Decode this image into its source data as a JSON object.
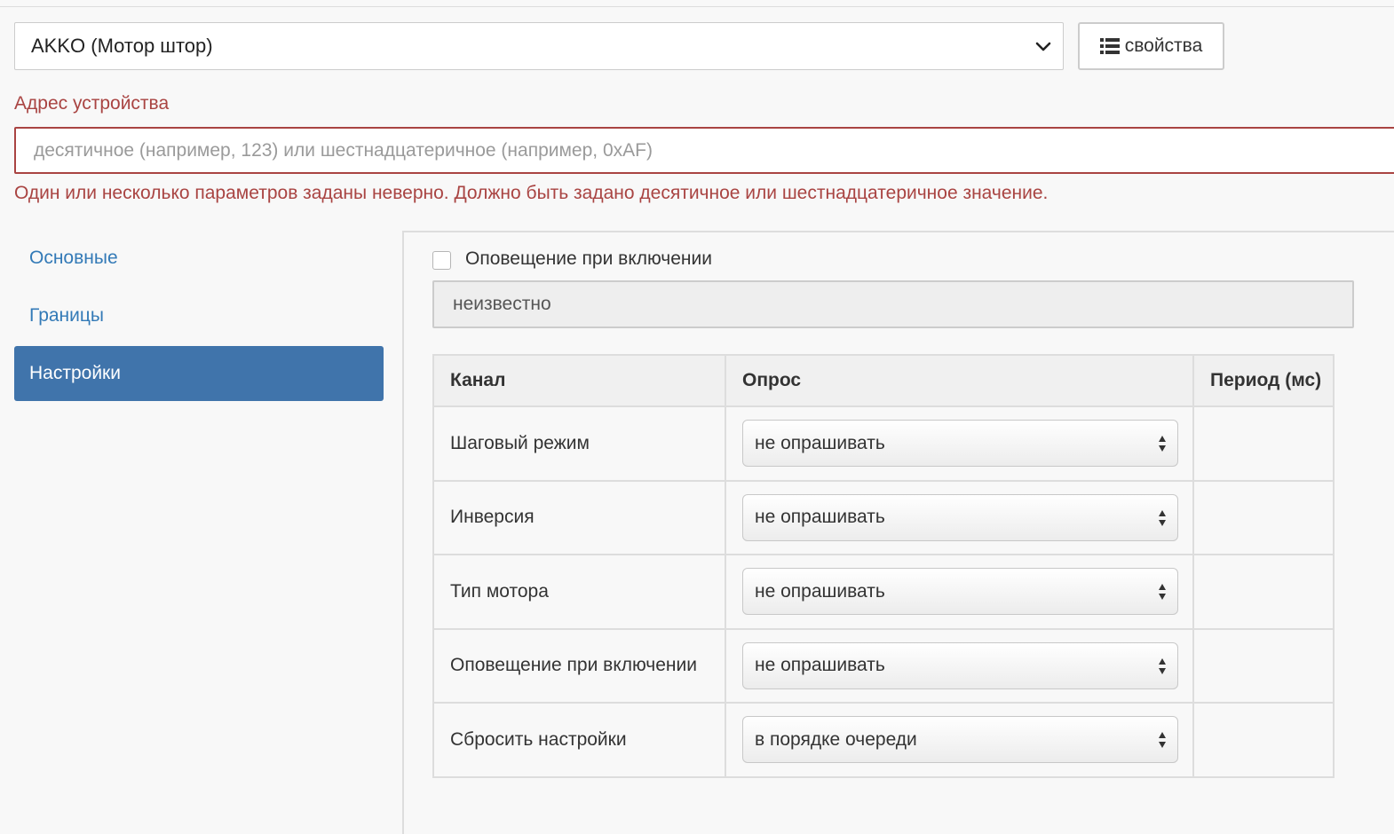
{
  "device": {
    "selected": "AKKO (Мотор штор)",
    "properties_button": "свойства"
  },
  "address": {
    "label": "Адрес устройства",
    "placeholder": "десятичное (например, 123) или шестнадцатеричное (например, 0xAF)",
    "value": "",
    "error": "Один или несколько параметров заданы неверно. Должно быть задано десятичное или шестнадцатеричное значение."
  },
  "sidebar": {
    "items": [
      {
        "label": "Основные",
        "active": false
      },
      {
        "label": "Границы",
        "active": false
      },
      {
        "label": "Настройки",
        "active": true
      }
    ]
  },
  "settings": {
    "notify_checkbox_label": "Оповещение при включении",
    "notify_checked": false,
    "status_value": "неизвестно"
  },
  "table": {
    "headers": [
      "Канал",
      "Опрос",
      "Период (мс)"
    ],
    "rows": [
      {
        "channel": "Шаговый режим",
        "poll": "не опрашивать",
        "period": ""
      },
      {
        "channel": "Инверсия",
        "poll": "не опрашивать",
        "period": ""
      },
      {
        "channel": "Тип мотора",
        "poll": "не опрашивать",
        "period": ""
      },
      {
        "channel": "Оповещение при включении",
        "poll": "не опрашивать",
        "period": ""
      },
      {
        "channel": "Сбросить настройки",
        "poll": "в порядке очереди",
        "period": ""
      }
    ]
  },
  "colors": {
    "error": "#a94442",
    "active_nav": "#4074ab",
    "link": "#337ab7"
  },
  "icons": {
    "select_caret": "chevron-down-icon",
    "properties": "list-icon",
    "poll_select": "updown-arrows-icon"
  }
}
